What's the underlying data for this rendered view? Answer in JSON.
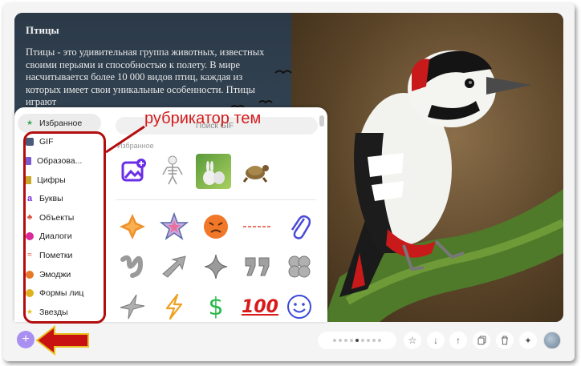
{
  "slide": {
    "title": "Птицы",
    "body": "Птицы - это удивительная группа животных, известных своими перьями и способностью к полету. В мире насчитывается более 10 000 видов птиц, каждая из которых имеет свои уникальные особенности. Птицы играют"
  },
  "annotation": {
    "text": "рубрикатор тем"
  },
  "sticker_panel": {
    "search_placeholder": "Поиск GIF",
    "section_favorites": "Избранное",
    "categories": [
      {
        "label": "Избранное",
        "icon": "star-icon",
        "color": "#3aa655"
      },
      {
        "label": "GIF",
        "icon": "gif-avatar-icon",
        "color": "#4a5a7a"
      },
      {
        "label": "Образова...",
        "icon": "book-icon",
        "color": "#7a5ad0"
      },
      {
        "label": "Цифры",
        "icon": "numbers-icon",
        "color": "#c8a828"
      },
      {
        "label": "Буквы",
        "icon": "letter-a-icon",
        "color": "#7a2ad8"
      },
      {
        "label": "Объекты",
        "icon": "plant-icon",
        "color": "#d84a3a"
      },
      {
        "label": "Диалоги",
        "icon": "speech-bubble-icon",
        "color": "#d82a9a"
      },
      {
        "label": "Пометки",
        "icon": "strikethrough-icon",
        "color": "#e04a3a"
      },
      {
        "label": "Эмоджи",
        "icon": "emoji-icon",
        "color": "#e8782a"
      },
      {
        "label": "Формы лиц",
        "icon": "face-shape-icon",
        "color": "#e0b020"
      },
      {
        "label": "Звезды",
        "icon": "star-icon",
        "color": "#e8c020"
      }
    ]
  },
  "toolbar": {
    "add_label": "+",
    "pages_total": 9,
    "page_current": 5
  },
  "colors": {
    "annotation": "#d41c1c",
    "accent": "#a98ff2"
  }
}
